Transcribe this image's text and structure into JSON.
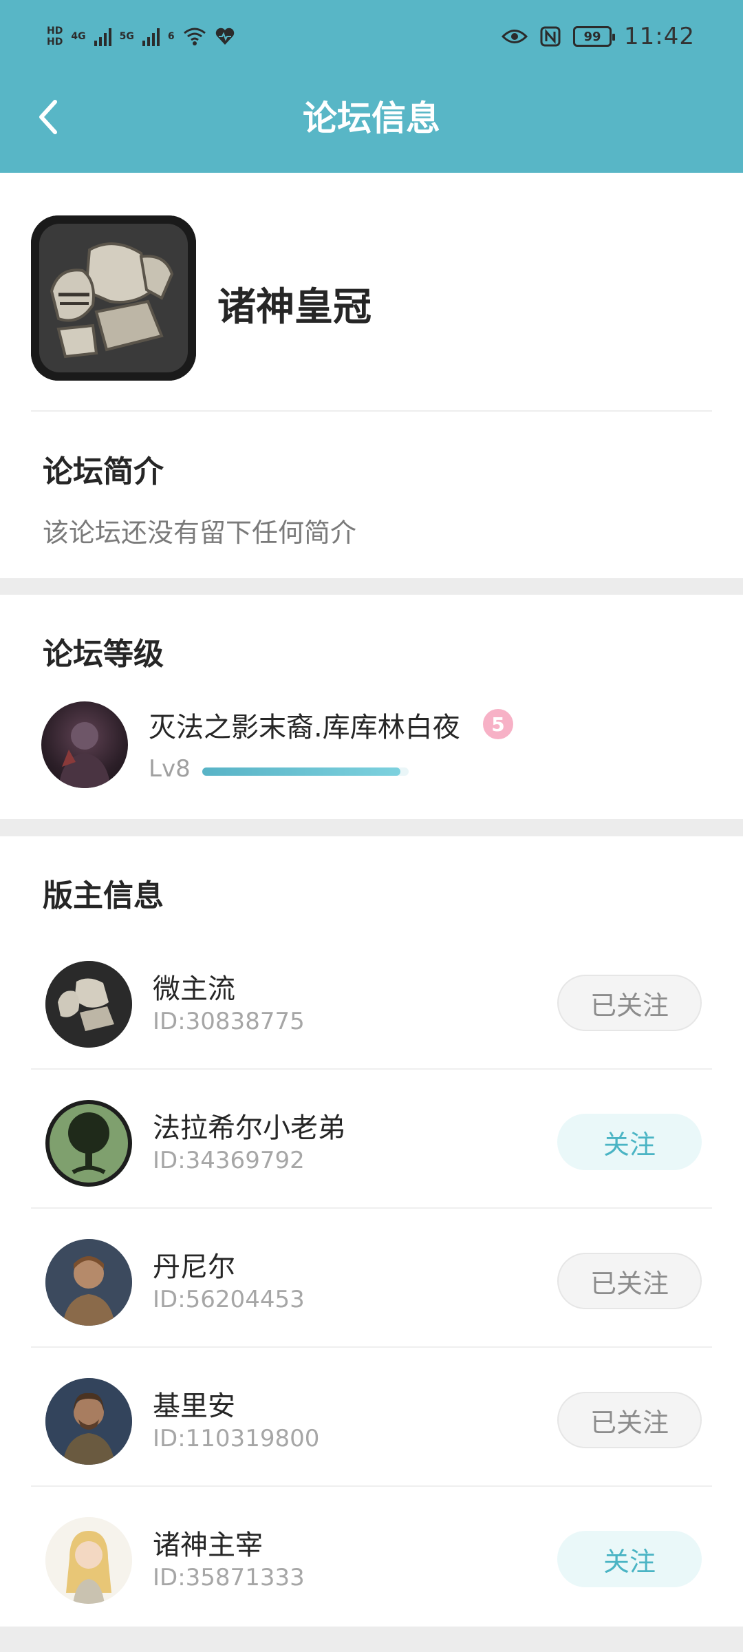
{
  "status_bar": {
    "hd1": "HD",
    "hd2": "HD",
    "net1": "4G",
    "net2": "5G",
    "wifi_mark": "6",
    "battery": "99",
    "time": "11:42"
  },
  "header": {
    "title": "论坛信息"
  },
  "forum": {
    "name": "诸神皇冠",
    "intro_title": "论坛简介",
    "intro_text": "该论坛还没有留下任何简介"
  },
  "forum_level": {
    "title": "论坛等级",
    "user_name": "灭法之影末裔.库库林白夜",
    "badge": "5",
    "level": "Lv8",
    "progress": 0.96
  },
  "moderators": {
    "title": "版主信息",
    "items": [
      {
        "name": "微主流",
        "id": "ID:30838775",
        "button": "已关注"
      },
      {
        "name": "法拉希尔小老弟",
        "id": "ID:34369792",
        "button": "关注"
      },
      {
        "name": "丹尼尔",
        "id": "ID:56204453",
        "button": "已关注"
      },
      {
        "name": "基里安",
        "id": "ID:110319800",
        "button": "已关注"
      },
      {
        "name": "诸神主宰",
        "id": "ID:35871333",
        "button": "关注"
      }
    ]
  },
  "colors": {
    "header_bg": "#58b6c6",
    "accent": "#4ab4c4",
    "follow_bg": "#eaf8f9",
    "followed_bg": "#f4f4f4"
  }
}
